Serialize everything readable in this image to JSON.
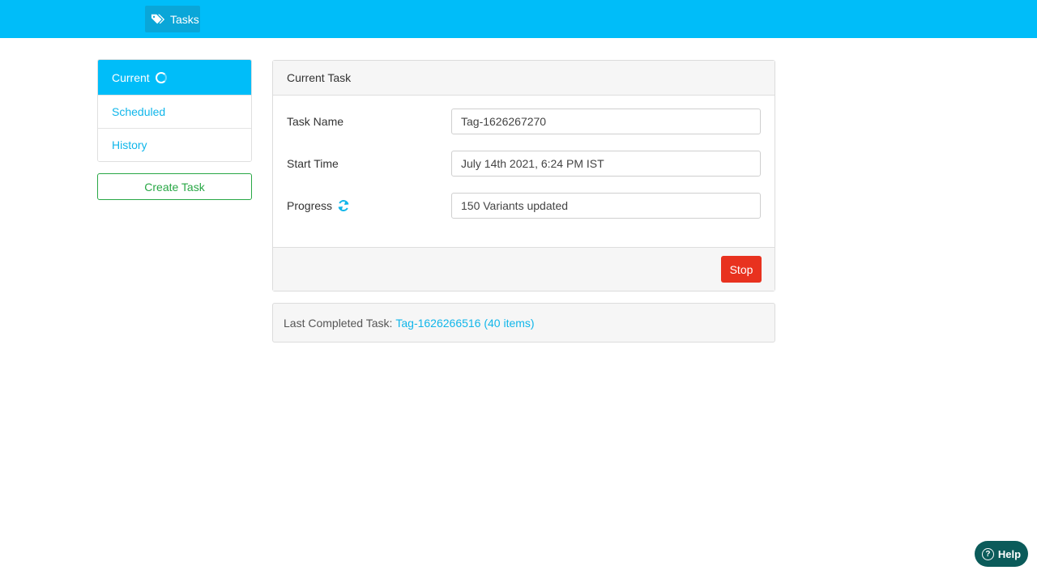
{
  "header": {
    "brand_label": "Tasks",
    "brand_icon": "tags-icon",
    "accent_color": "#00bdf9"
  },
  "sidebar": {
    "items": [
      {
        "label": "Current",
        "active": true
      },
      {
        "label": "Scheduled",
        "active": false
      },
      {
        "label": "History",
        "active": false
      }
    ],
    "create_button": "Create Task"
  },
  "current_task": {
    "title": "Current Task",
    "fields": {
      "task_name_label": "Task Name",
      "task_name_value": "Tag-1626267270",
      "start_time_label": "Start Time",
      "start_time_value": "July 14th 2021, 6:24 PM IST",
      "progress_label": "Progress",
      "progress_value": "150 Variants updated"
    },
    "stop_button": "Stop",
    "stop_color": "#e8321f"
  },
  "last_completed": {
    "prefix": "Last Completed Task:",
    "link_text": "Tag-1626266516 (40 items)"
  },
  "help": {
    "label": "Help"
  }
}
